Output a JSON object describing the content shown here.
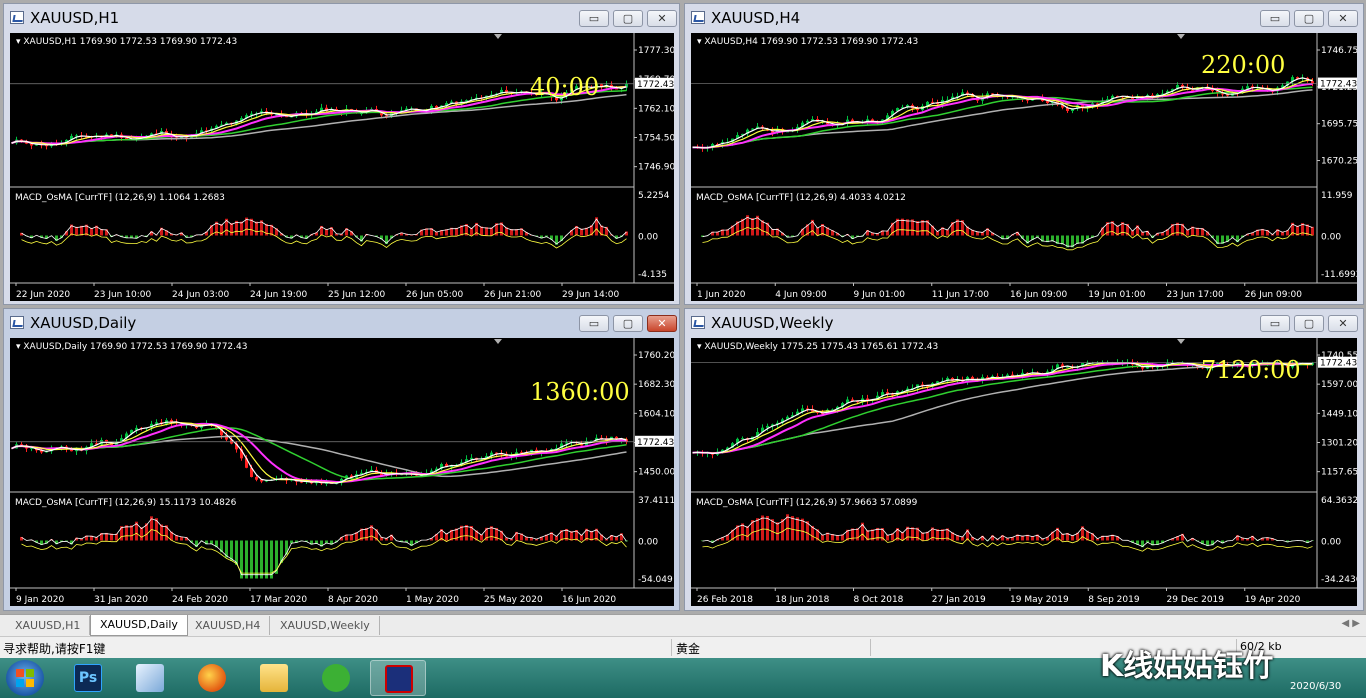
{
  "charts": [
    {
      "id": "h1",
      "title": "XAUUSD,H1",
      "info": "XAUUSD,H1  1769.90 1772.53 1769.90 1772.43",
      "timer": "40:00",
      "price_label": "1772.43",
      "price_ticks": [
        "1777.30",
        "1769.70",
        "1762.10",
        "1754.50",
        "1746.90"
      ],
      "macd_title": "MACD_OsMA [CurrTF] (12,26,9) 1.1064 1.2683",
      "macd_ticks": [
        "5.2254",
        "0.00",
        "-4.135"
      ],
      "time_labels": [
        "22 Jun 2020",
        "23 Jun 10:00",
        "24 Jun 03:00",
        "24 Jun 19:00",
        "25 Jun 12:00",
        "26 Jun 05:00",
        "26 Jun 21:00",
        "29 Jun 14:00"
      ],
      "close_red": false
    },
    {
      "id": "h4",
      "title": "XAUUSD,H4",
      "info": "XAUUSD,H4  1769.90 1772.53 1769.90 1772.43",
      "timer": "220:00",
      "price_label": "1772.43",
      "price_ticks": [
        "1746.75",
        "1721.25",
        "1695.75",
        "1670.25"
      ],
      "macd_title": "MACD_OsMA [CurrTF] (12,26,9) 4.4033 4.0212",
      "macd_ticks": [
        "11.959",
        "0.00",
        "-11.6992"
      ],
      "time_labels": [
        "1 Jun 2020",
        "4 Jun 09:00",
        "9 Jun 01:00",
        "11 Jun 17:00",
        "16 Jun 09:00",
        "19 Jun 01:00",
        "23 Jun 17:00",
        "26 Jun 09:00"
      ],
      "close_red": false
    },
    {
      "id": "daily",
      "title": "XAUUSD,Daily",
      "info": "XAUUSD,Daily  1769.90 1772.53 1769.90 1772.43",
      "timer": "1360:00",
      "price_label": "1772.43",
      "price_ticks": [
        "1760.20",
        "1682.30",
        "1604.10",
        "1525.90",
        "1450.00"
      ],
      "macd_title": "MACD_OsMA [CurrTF] (12,26,9) 15.1173 10.4826",
      "macd_ticks": [
        "37.4111",
        "0.00",
        "-54.049"
      ],
      "time_labels": [
        "9 Jan 2020",
        "31 Jan 2020",
        "24 Feb 2020",
        "17 Mar 2020",
        "8 Apr 2020",
        "1 May 2020",
        "25 May 2020",
        "16 Jun 2020"
      ],
      "close_red": true
    },
    {
      "id": "weekly",
      "title": "XAUUSD,Weekly",
      "info": "XAUUSD,Weekly  1775.25 1775.43 1765.61 1772.43",
      "timer": "7120:00",
      "price_label": "1772.43",
      "price_ticks": [
        "1740.55",
        "1597.00",
        "1449.10",
        "1301.20",
        "1157.65"
      ],
      "macd_title": "MACD_OsMA [CurrTF] (12,26,9) 57.9663 57.0899",
      "macd_ticks": [
        "64.3632",
        "0.00",
        "-34.2436"
      ],
      "time_labels": [
        "26 Feb 2018",
        "18 Jun 2018",
        "8 Oct 2018",
        "27 Jan 2019",
        "19 May 2019",
        "8 Sep 2019",
        "29 Dec 2019",
        "19 Apr 2020"
      ],
      "close_red": false
    }
  ],
  "window_buttons": {
    "minimize": "▭",
    "maximize": "▢",
    "close": "✕"
  },
  "tabs": [
    "XAUUSD,H1",
    "XAUUSD,Daily",
    "XAUUSD,H4",
    "XAUUSD,Weekly"
  ],
  "active_tab": "XAUUSD,Daily",
  "status": {
    "help": "寻求帮助,请按F1键",
    "symbol": "黄金",
    "traffic": "60/2 kb"
  },
  "watermark": "K线姑姑钰竹",
  "tray_date": "2020/6/30",
  "taskbar_icons": [
    "windows-start-icon",
    "photoshop-icon",
    "paint-icon",
    "firefox-icon",
    "file-explorer-icon",
    "wechat-icon",
    "metatrader-icon"
  ],
  "colors": {
    "bull": "#00c040",
    "bear": "#ff2020",
    "ma_fast": "#ffffff",
    "ma_yellow": "#ffff40",
    "ma_magenta": "#ff30ff",
    "ma_green": "#30d030",
    "ma_gray": "#b0b0b0",
    "timer": "#ffff40"
  }
}
